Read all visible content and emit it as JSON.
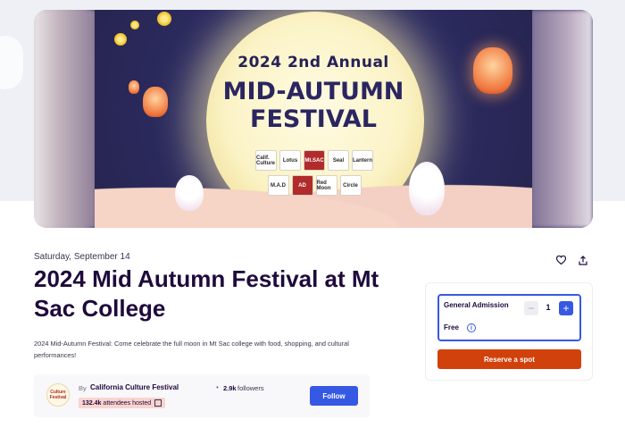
{
  "hero": {
    "line1": "2024 2nd Annual",
    "line2a": "MID-AUTUMN",
    "line2b": "FESTIVAL",
    "sponsor_logos_row1": [
      "Calif. Culture",
      "Lotus",
      "Mt.SAC",
      "Seal",
      "Lantern"
    ],
    "sponsor_logos_row2": [
      "M.A.D",
      "AD",
      "Red Moon",
      "Circle"
    ]
  },
  "event": {
    "date": "Saturday, September 14",
    "title": "2024 Mid Autumn Festival at Mt Sac College",
    "summary": "2024 Mid-Autumn Festival: Come celebrate the full moon in Mt Sac college with food, shopping, and cultural performances!"
  },
  "actions": {
    "like_icon": "heart-icon",
    "share_icon": "share-icon"
  },
  "organizer": {
    "logo_text": "Culture Festival",
    "by_label": "By",
    "name": "California Culture Festival",
    "followers_count": "2.9k",
    "followers_label": "followers",
    "attendees_count": "132.4k",
    "attendees_label": "attendees hosted",
    "follow_label": "Follow"
  },
  "ticket": {
    "name": "General Admission",
    "price": "Free",
    "quantity": "1",
    "minus_icon": "minus-icon",
    "plus_icon": "plus-icon",
    "reserve_label": "Reserve a spot"
  },
  "colors": {
    "primary_blue": "#3659e3",
    "reserve_orange": "#d1410c",
    "heading": "#1e0a3c",
    "badge_pink": "#fbd3cf"
  }
}
